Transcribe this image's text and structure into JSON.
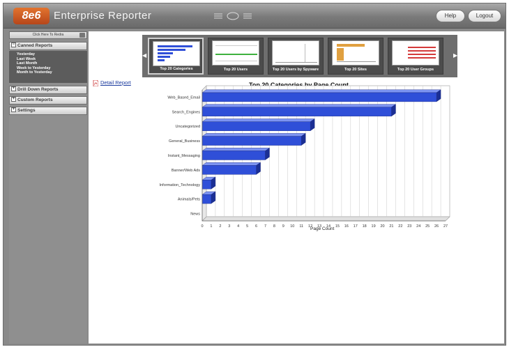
{
  "header": {
    "logo": "8e6",
    "app_title": "Enterprise Reporter",
    "help_label": "Help",
    "logout_label": "Logout"
  },
  "sidebar": {
    "redraw_label": "Click Here To Redra",
    "sections": [
      {
        "label": "Canned Reports",
        "expanded": true
      },
      {
        "label": "Drill Down Reports",
        "expanded": false
      },
      {
        "label": "Custom Reports",
        "expanded": false
      },
      {
        "label": "Settings",
        "expanded": false
      }
    ],
    "canned_items": [
      "Yesterday",
      "Last Week",
      "Last Month",
      "Week to Yesterday",
      "Month to Yesterday"
    ]
  },
  "carousel": {
    "thumbnails": [
      {
        "label": "Top 20 Categories",
        "active": true
      },
      {
        "label": "Top 20 Users",
        "active": false
      },
      {
        "label": "Top 20 Users by Spyware",
        "active": false
      },
      {
        "label": "Top 20 Sites",
        "active": false
      },
      {
        "label": "Top 20 User Groups",
        "active": false
      }
    ]
  },
  "report": {
    "detail_link": "Detail Report"
  },
  "colors": {
    "bar_front": "#2f4fd8",
    "bar_top": "#7d94f2",
    "bar_side": "#1b2f94",
    "accent_orange": "#c9561f"
  },
  "chart_data": {
    "type": "bar",
    "orientation": "horizontal",
    "title": "Top 20 Categories by Page Count",
    "xlabel": "Page Count",
    "ylabel": "",
    "categories": [
      "Web_Based_Email",
      "Search_Engines",
      "Uncategorized",
      "General_Business",
      "Instant_Messaging",
      "Banner/Web Ads",
      "Information_Technology",
      "Animals/Pets",
      "News"
    ],
    "values": [
      26,
      21,
      12,
      11,
      7,
      6,
      1,
      1,
      0
    ],
    "xlim": [
      0,
      27
    ],
    "xticks": [
      "0",
      "1",
      "2",
      "3",
      "4",
      "5",
      "6",
      "7",
      "8",
      "9",
      "10",
      "11",
      "12",
      "13",
      "14",
      "15",
      "16",
      "17",
      "18",
      "19",
      "20",
      "21",
      "22",
      "23",
      "24",
      "25",
      "26",
      "27"
    ],
    "grid": true
  }
}
